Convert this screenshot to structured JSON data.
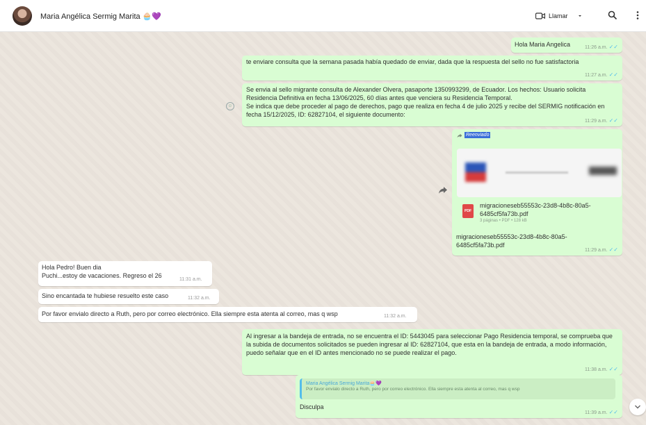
{
  "header": {
    "contact_name": "Maria Angélica Sermig Marita 🧁💜",
    "call_label": "Llamar"
  },
  "messages": [
    {
      "text": "Hola Maria Angelica",
      "time": "11:26 a.m."
    },
    {
      "text": "te enviare consulta que la semana pasada había quedado de enviar, dada que la respuesta del sello no fue satisfactoria",
      "time": "11:27 a.m."
    },
    {
      "text": "Se envia al sello migrante consulta de Alexander Olvera, pasaporte 1350993299, de Ecuador. Los hechos: Usuario solicita Residencia Definitiva en fecha 13/06/2025, 60 días antes  que venciera su Residencia Temporal.",
      "text2": "Se indica que debe proceder al pago de derechos, pago que realiza  en fecha 4 de julio 2025 y recibe del SERMIG notificación en fecha 15/12/2025, ID: 62827104, el siguiente documento:",
      "time": "11:29 a.m."
    },
    {
      "forwarded_label": "Reenviado",
      "file_name": "migracioneseb55553c-23d8-4b8c-80a5-6485cf5fa73b.pdf",
      "file_meta": "3 páginas • PDF • 128 kB",
      "caption": "migracioneseb55553c-23d8-4b8c-80a5-6485cf5fa73b.pdf",
      "time": "11:29 a.m."
    },
    {
      "line1": "Hola Pedro! Buen dia",
      "line2": "Puchi...estoy de vacaciones. Regreso el 26",
      "time": "11:31 a.m."
    },
    {
      "text": "Sino encantada te hubiese resuelto este caso",
      "time": "11:32 a.m."
    },
    {
      "text": "Por favor envialo directo a Ruth, pero por correo electrónico. Ella siempre esta atenta al correo, mas q wsp",
      "time": "11:32 a.m."
    },
    {
      "text": "Al ingresar a la bandeja de entrada, no se encuentra el ID: 5443045 para seleccionar Pago Residencia temporal, se comprueba que la subida de documentos solicitados se pueden ingresar al ID: 62827104, que esta en la bandeja de entrada, a modo información, puedo señalar que en el ID antes mencionado no se puede realizar  el pago.",
      "time": "11:38 a.m."
    },
    {
      "quote_author": "Maria Angélica Sermig Marita🧁💜",
      "quote_text": "Por favor envialo directo a Ruth, pero por correo electrónico. Ella siempre esta atenta al correo, mas q wsp",
      "text": "Disculpa",
      "time": "11:39 a.m."
    }
  ],
  "colors": {
    "outgoing": "#d9fdd3",
    "incoming": "#ffffff",
    "accent": "#53bdeb"
  },
  "icons": [
    "video-icon",
    "chevron-down-icon",
    "search-icon",
    "kebab-menu-icon",
    "emoji-icon",
    "forward-icon",
    "pdf-icon",
    "scroll-down-icon"
  ]
}
